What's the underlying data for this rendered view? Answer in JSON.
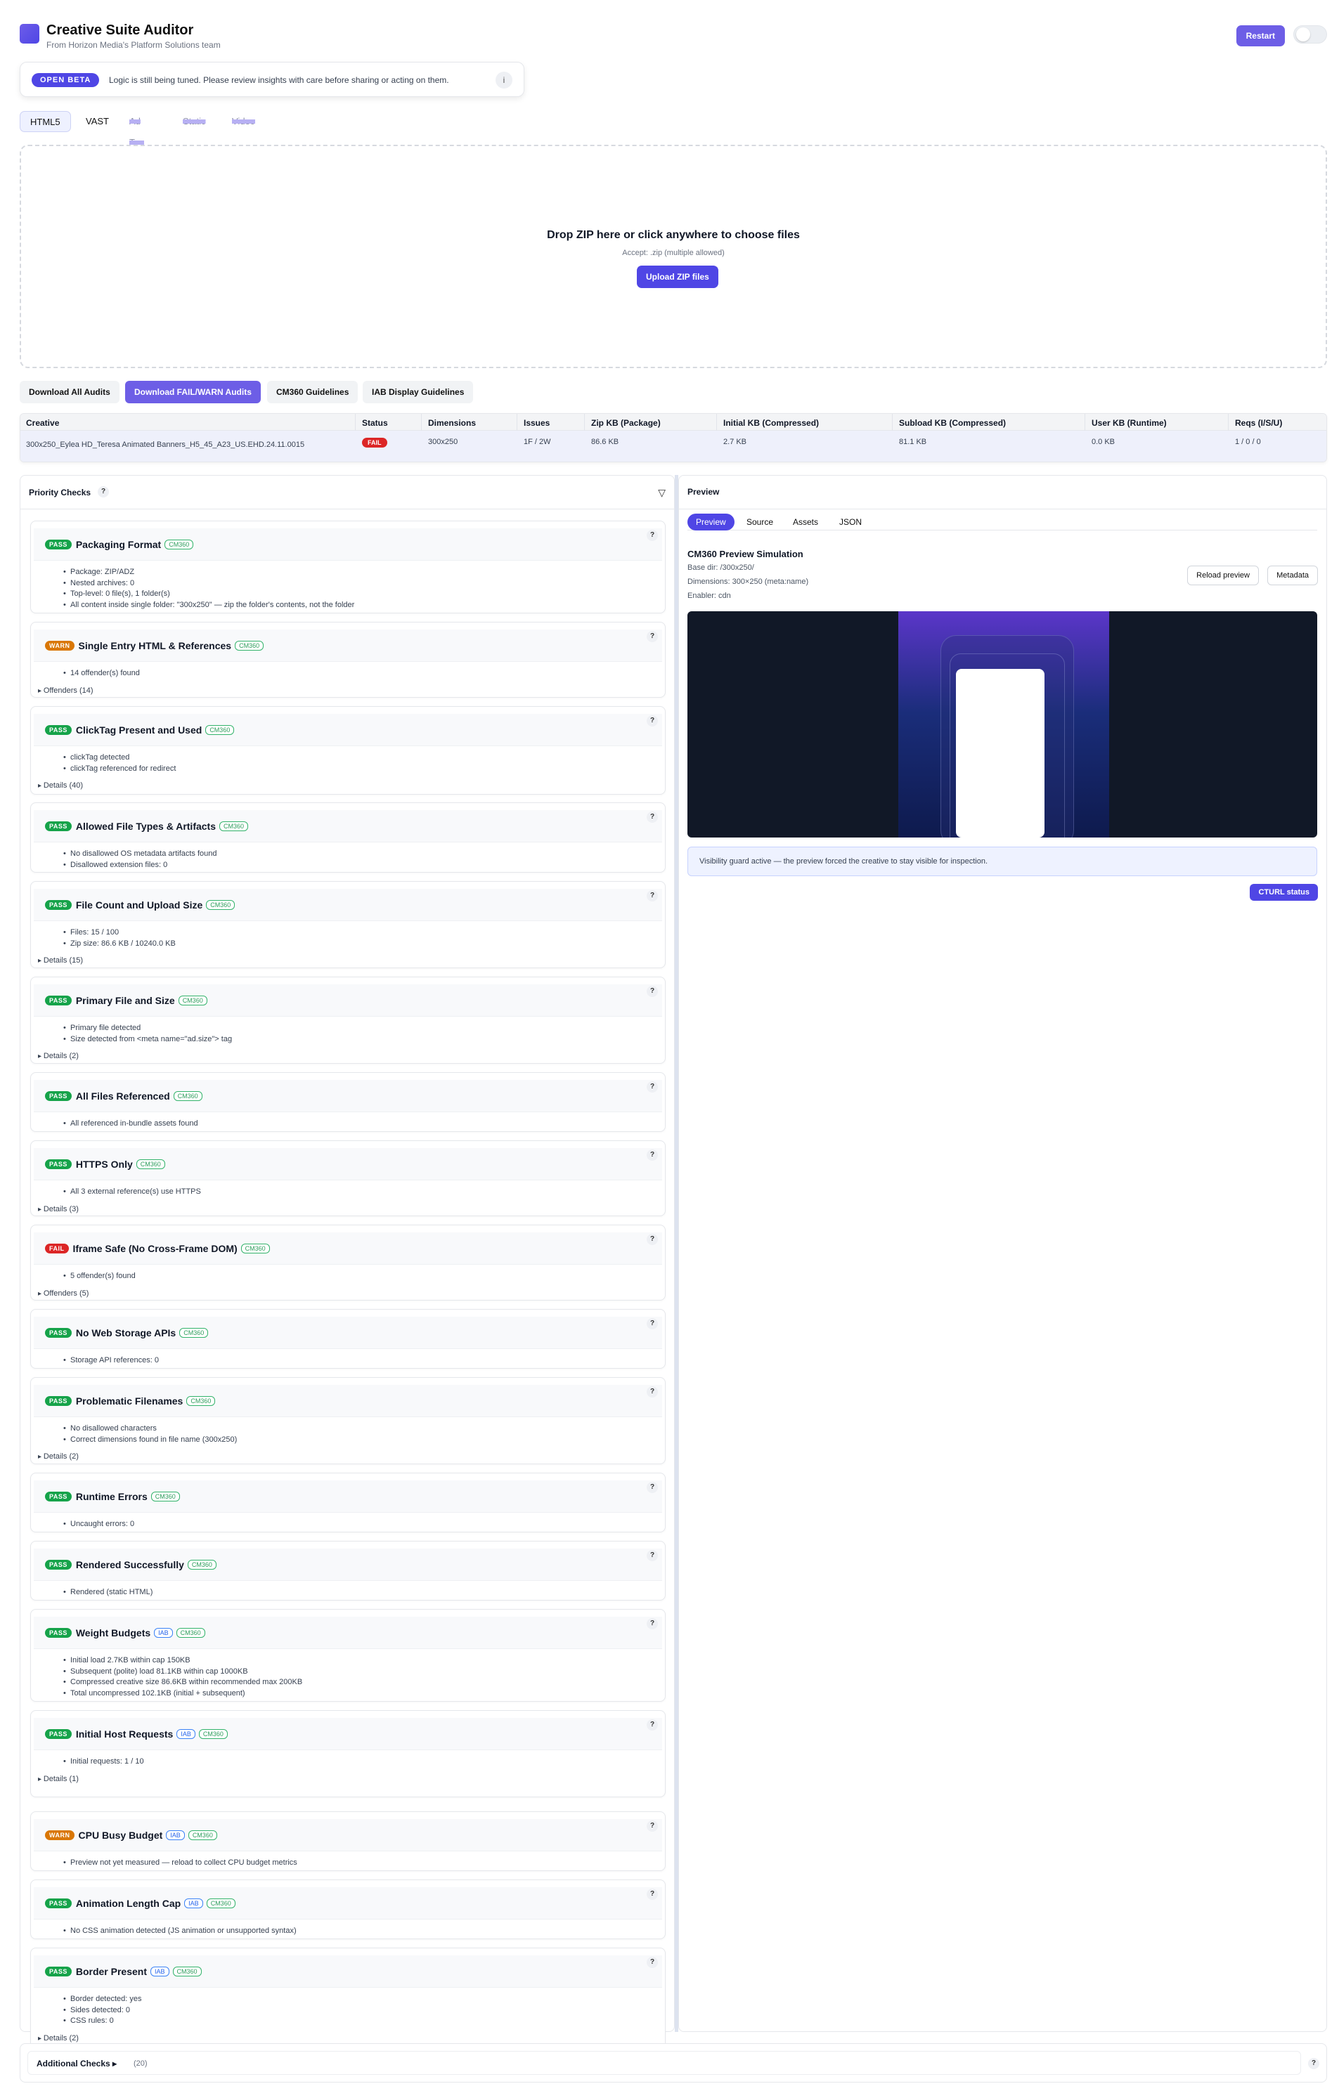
{
  "app": {
    "title": "Creative Suite Auditor",
    "subtitle": "From Horizon Media's Platform Solutions team",
    "restart_label": "Restart"
  },
  "beta": {
    "badge": "OPEN BETA",
    "message": "Logic is still being tuned. Please review insights with care before sharing or acting on them.",
    "info_icon": "i"
  },
  "type_tabs": [
    {
      "label": "HTML5",
      "state": "active"
    },
    {
      "label": "VAST",
      "state": "normal"
    },
    {
      "label": "Ad Tag",
      "state": "disabled"
    },
    {
      "label": "Static",
      "state": "disabled"
    },
    {
      "label": "Video",
      "state": "disabled"
    }
  ],
  "dropzone": {
    "title": "Drop ZIP here or click anywhere to choose files",
    "accept": "Accept: .zip (multiple allowed)",
    "button": "Upload ZIP files"
  },
  "downloads": [
    "Download All Audits",
    "Download FAIL/WARN Audits",
    "CM360 Guidelines",
    "IAB Display Guidelines"
  ],
  "table": {
    "headers": [
      "Creative",
      "Status",
      "Dimensions",
      "Issues",
      "Zip KB (Package)",
      "Initial KB (Compressed)",
      "Subload KB (Compressed)",
      "User KB (Runtime)",
      "Reqs (I/S/U)"
    ],
    "row": {
      "creative": "300x250_Eylea HD_Teresa Animated Banners_H5_45_A23_US.EHD.24.11.0015",
      "status": "FAIL",
      "dimensions": "300x250",
      "issues": "1F / 2W",
      "zip_kb": "86.6 KB",
      "initial_kb": "2.7 KB",
      "subload_kb": "81.1 KB",
      "user_kb": "0.0 KB",
      "reqs": "1 / 0 / 0"
    }
  },
  "priority": {
    "title": "Priority Checks",
    "help": "?",
    "filter_icon": "▽",
    "checks": [
      {
        "status": "PASS",
        "title": "Packaging Format",
        "tags": [
          "CM360"
        ],
        "items": [
          "Package: ZIP/ADZ",
          "Nested archives: 0",
          "Top-level: 0 file(s), 1 folder(s)",
          "All content inside single folder: \"300x250\" — zip the folder's contents, not the folder"
        ],
        "details": ""
      },
      {
        "status": "WARN",
        "title": "Single Entry HTML & References",
        "tags": [
          "CM360"
        ],
        "items": [
          "14 offender(s) found"
        ],
        "details": "Offenders (14)"
      },
      {
        "status": "PASS",
        "title": "ClickTag Present and Used",
        "tags": [
          "CM360"
        ],
        "items": [
          "clickTag detected",
          "clickTag referenced for redirect"
        ],
        "details": "Details (40)"
      },
      {
        "status": "PASS",
        "title": "Allowed File Types & Artifacts",
        "tags": [
          "CM360"
        ],
        "items": [
          "No disallowed OS metadata artifacts found",
          "Disallowed extension files: 0"
        ],
        "details": ""
      },
      {
        "status": "PASS",
        "title": "File Count and Upload Size",
        "tags": [
          "CM360"
        ],
        "items": [
          "Files: 15 / 100",
          "Zip size: 86.6 KB / 10240.0 KB"
        ],
        "details": "Details (15)"
      },
      {
        "status": "PASS",
        "title": "Primary File and Size",
        "tags": [
          "CM360"
        ],
        "items": [
          "Primary file detected",
          "Size detected from <meta name=\"ad.size\"> tag"
        ],
        "details": "Details (2)"
      },
      {
        "status": "PASS",
        "title": "All Files Referenced",
        "tags": [
          "CM360"
        ],
        "items": [
          "All referenced in-bundle assets found"
        ],
        "details": ""
      },
      {
        "status": "PASS",
        "title": "HTTPS Only",
        "tags": [
          "CM360"
        ],
        "items": [
          "All 3 external reference(s) use HTTPS"
        ],
        "details": "Details (3)"
      },
      {
        "status": "FAIL",
        "title": "Iframe Safe (No Cross-Frame DOM)",
        "tags": [
          "CM360"
        ],
        "items": [
          "5 offender(s) found"
        ],
        "details": "Offenders (5)"
      },
      {
        "status": "PASS",
        "title": "No Web Storage APIs",
        "tags": [
          "CM360"
        ],
        "items": [
          "Storage API references: 0"
        ],
        "details": ""
      },
      {
        "status": "PASS",
        "title": "Problematic Filenames",
        "tags": [
          "CM360"
        ],
        "items": [
          "No disallowed characters",
          "Correct dimensions found in file name (300x250)"
        ],
        "details": "Details (2)"
      },
      {
        "status": "PASS",
        "title": "Runtime Errors",
        "tags": [
          "CM360"
        ],
        "items": [
          "Uncaught errors: 0"
        ],
        "details": ""
      },
      {
        "status": "PASS",
        "title": "Rendered Successfully",
        "tags": [
          "CM360"
        ],
        "items": [
          "Rendered (static HTML)"
        ],
        "details": ""
      },
      {
        "status": "PASS",
        "title": "Weight Budgets",
        "tags": [
          "IAB",
          "CM360"
        ],
        "items": [
          "Initial load 2.7KB within cap 150KB",
          "Subsequent (polite) load 81.1KB within cap 1000KB",
          "Compressed creative size 86.6KB within recommended max 200KB",
          "Total uncompressed 102.1KB (initial + subsequent)"
        ],
        "details": ""
      },
      {
        "status": "PASS",
        "title": "Initial Host Requests",
        "tags": [
          "IAB",
          "CM360"
        ],
        "items": [
          "Initial requests: 1 / 10"
        ],
        "details": "Details (1)"
      },
      {
        "status": "WARN",
        "title": "CPU Busy Budget",
        "tags": [
          "IAB",
          "CM360"
        ],
        "items": [
          "Preview not yet measured — reload to collect CPU budget metrics"
        ],
        "details": ""
      },
      {
        "status": "PASS",
        "title": "Animation Length Cap",
        "tags": [
          "IAB",
          "CM360"
        ],
        "items": [
          "No CSS animation detected (JS animation or unsupported syntax)"
        ],
        "details": ""
      },
      {
        "status": "PASS",
        "title": "Border Present",
        "tags": [
          "IAB",
          "CM360"
        ],
        "items": [
          "Border detected: yes",
          "Sides detected: 0",
          "CSS rules: 0"
        ],
        "details": "Details (2)"
      }
    ]
  },
  "preview": {
    "title": "Preview",
    "tabs": [
      "Preview",
      "Source",
      "Assets",
      "JSON"
    ],
    "sim_title": "CM360 Preview Simulation",
    "base_dir": "Base dir: /300x250/",
    "dimensions": "Dimensions: 300×250 (meta:name)",
    "enabler": "Enabler: cdn",
    "reload": "Reload preview",
    "metadata": "Metadata",
    "guard": "Visibility guard active — the preview forced the creative to stay visible for inspection.",
    "cturl": "CTURL status"
  },
  "additional": {
    "title": "Additional Checks ▸",
    "count": "(20)",
    "help": "?"
  }
}
